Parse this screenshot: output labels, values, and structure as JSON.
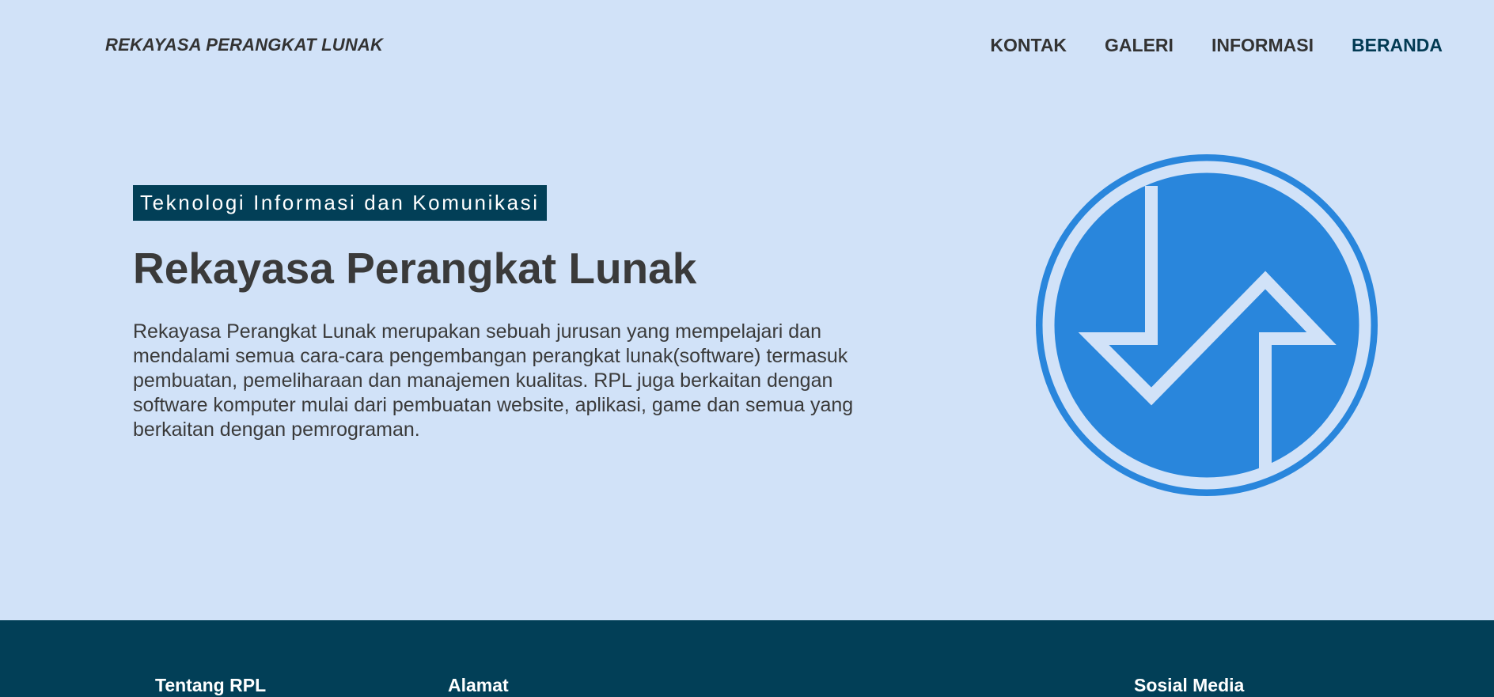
{
  "header": {
    "brand": "REKAYASA PERANGKAT LUNAK",
    "nav": [
      {
        "label": "KONTAK"
      },
      {
        "label": "GALERI"
      },
      {
        "label": "INFORMASI"
      },
      {
        "label": "BERANDA"
      }
    ]
  },
  "hero": {
    "tag": "Teknologi Informasi dan Komunikasi",
    "title": "Rekayasa Perangkat Lunak",
    "description": "Rekayasa Perangkat Lunak merupakan sebuah jurusan yang mempelajari dan mendalami semua cara-cara pengembangan perangkat lunak(software) termasuk pembuatan, pemeliharaan dan manajemen kualitas. RPL juga berkaitan dengan software komputer mulai dari pembuatan website, aplikasi, game dan semua yang berkaitan dengan pemrograman.",
    "logo_icon": "rpl-logo-icon"
  },
  "footer": {
    "col1_heading": "Tentang RPL",
    "col2_heading": "Alamat",
    "col3_heading": "Sosial Media"
  },
  "colors": {
    "background": "#d1e2f8",
    "accent_dark": "#023f57",
    "logo_blue": "#2986dc",
    "text": "#333333"
  }
}
